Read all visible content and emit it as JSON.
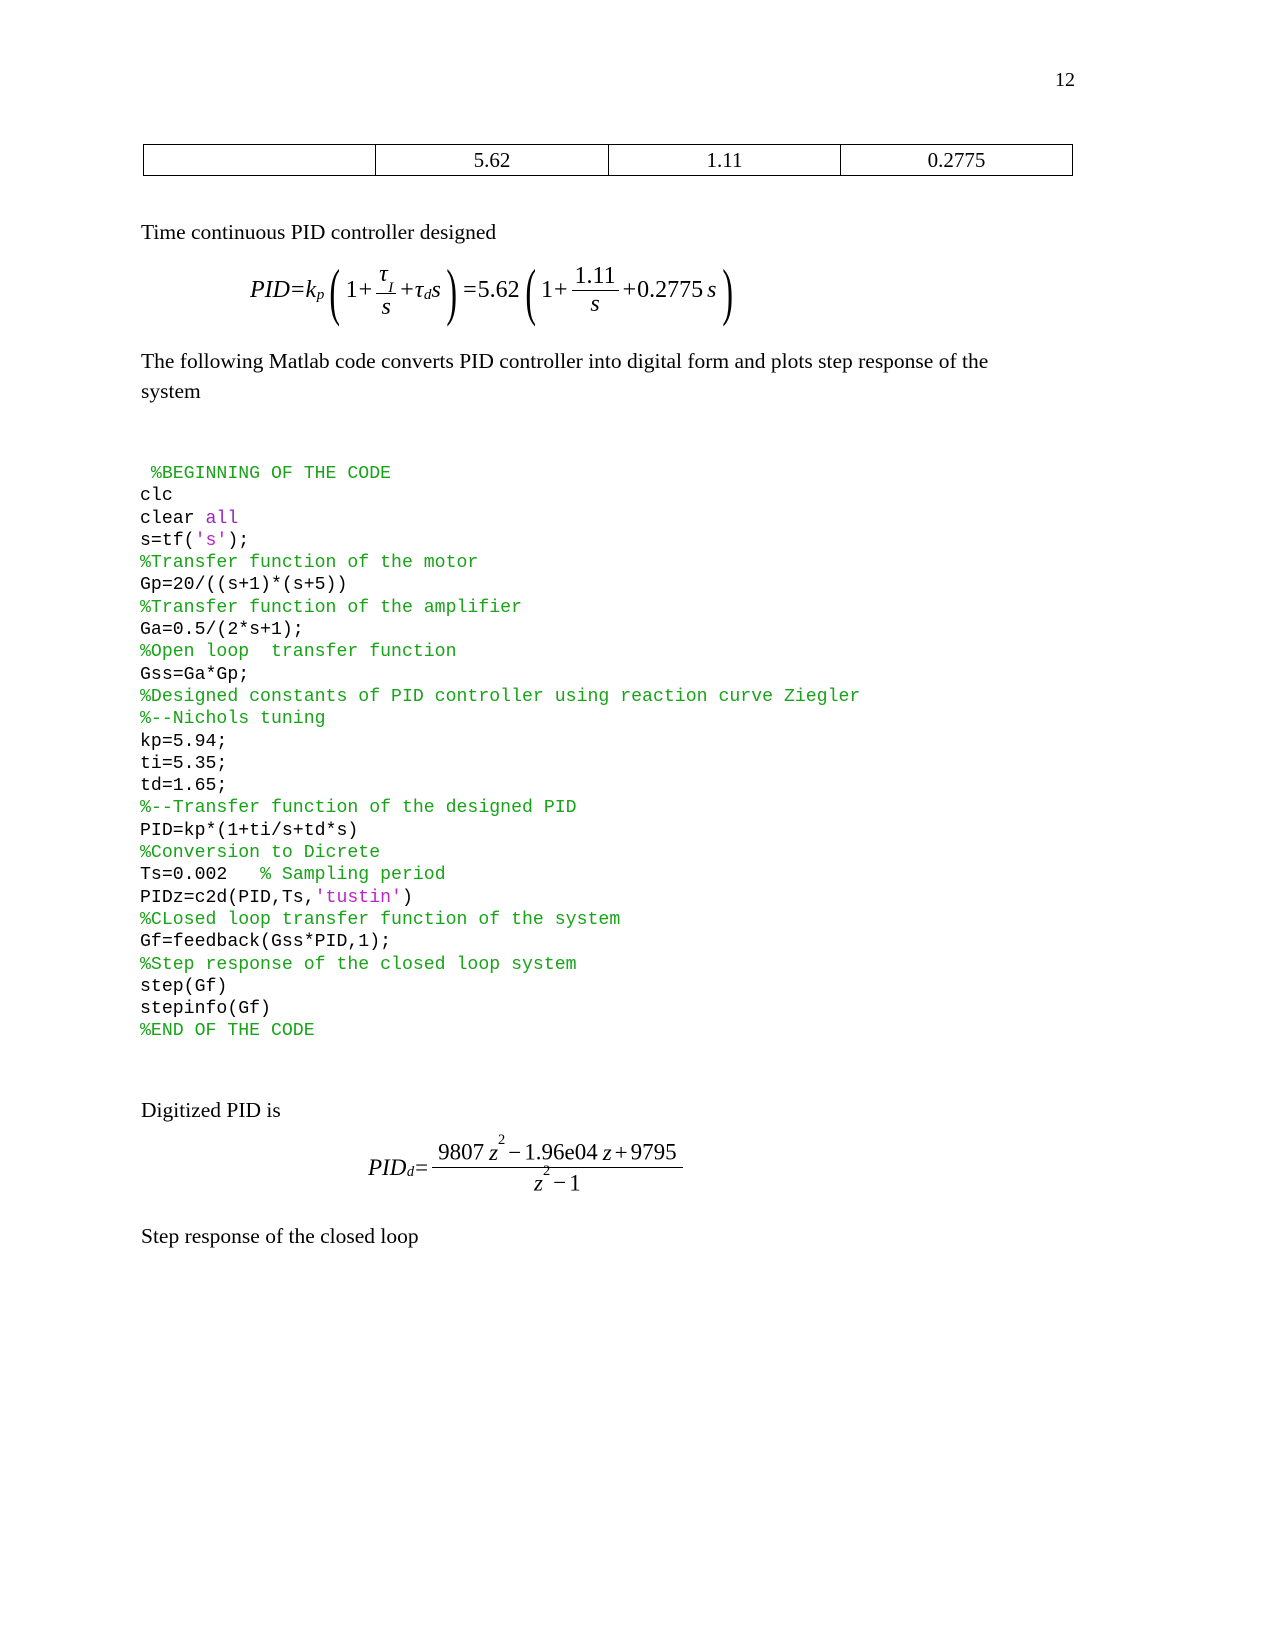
{
  "document": {
    "page_number": "12"
  },
  "table": {
    "rows": [
      {
        "cells": [
          "",
          "5.62",
          "1.11",
          "0.2775"
        ]
      }
    ]
  },
  "paragraphs": {
    "p1": "Time continuous PID controller designed",
    "p2": "The following Matlab code converts PID controller into digital form and plots step response of the system",
    "p3": "Digitized PID is",
    "p4": "Step response of the closed loop"
  },
  "equation_pid": {
    "lhs": "PID",
    "eq1": "=",
    "gain": "k",
    "gain_sub": "p",
    "open1": "(",
    "t1_one": "1",
    "t1_plus1": "+",
    "t1_num": "τ",
    "t1_num_sub": "I",
    "t1_den": "s",
    "t1_plus2": "+",
    "t1_tau": "τ",
    "t1_tau_sub": "d",
    "t1_s": "s",
    "close1": ")",
    "eq2": "=",
    "kp_value": "5.62",
    "open2": "(",
    "t2_one": "1",
    "t2_plus1": "+",
    "t2_num": "1.11",
    "t2_den": "s",
    "t2_plus2": "+",
    "t2_td": "0.2775",
    "t2_s": "s",
    "close2": ")"
  },
  "equation_digital": {
    "lhs": "PID",
    "lhs_sub": "d",
    "equals": "=",
    "numerator_a": "9807",
    "numerator_z1": "z",
    "numerator_z1_exp": "2",
    "numerator_minus": "−",
    "numerator_b": "1.96e04",
    "numerator_z2": "z",
    "numerator_plus": "+",
    "numerator_c": "9795",
    "denominator_z": "z",
    "denominator_exp": "2",
    "denominator_minus": "−",
    "denominator_one": "1"
  },
  "code": {
    "language": "matlab",
    "colors": {
      "comment": "#19a319",
      "string": "#b828c8",
      "keyword": "#9a25c2",
      "plain": "#000000"
    },
    "lines": [
      [
        {
          "t": "comment",
          "s": " %BEGINNING OF THE CODE"
        }
      ],
      [
        {
          "t": "plain",
          "s": "clc"
        }
      ],
      [
        {
          "t": "plain",
          "s": "clear "
        },
        {
          "t": "keyword",
          "s": "all"
        }
      ],
      [
        {
          "t": "plain",
          "s": "s=tf("
        },
        {
          "t": "string",
          "s": "'s'"
        },
        {
          "t": "plain",
          "s": ");"
        }
      ],
      [
        {
          "t": "comment",
          "s": "%Transfer function of the motor"
        }
      ],
      [
        {
          "t": "plain",
          "s": "Gp=20/((s+1)*(s+5))"
        }
      ],
      [
        {
          "t": "comment",
          "s": "%Transfer function of the amplifier"
        }
      ],
      [
        {
          "t": "plain",
          "s": "Ga=0.5/(2*s+1);"
        }
      ],
      [
        {
          "t": "comment",
          "s": "%Open loop  transfer function"
        }
      ],
      [
        {
          "t": "plain",
          "s": "Gss=Ga*Gp;"
        }
      ],
      [
        {
          "t": "comment",
          "s": "%Designed constants of PID controller using reaction curve Ziegler"
        }
      ],
      [
        {
          "t": "comment",
          "s": "%--Nichols tuning"
        }
      ],
      [
        {
          "t": "plain",
          "s": "kp=5.94;"
        }
      ],
      [
        {
          "t": "plain",
          "s": "ti=5.35;"
        }
      ],
      [
        {
          "t": "plain",
          "s": "td=1.65;"
        }
      ],
      [
        {
          "t": "comment",
          "s": "%--Transfer function of the designed PID"
        }
      ],
      [
        {
          "t": "plain",
          "s": "PID=kp*(1+ti/s+td*s)"
        }
      ],
      [
        {
          "t": "comment",
          "s": "%Conversion to Dicrete"
        }
      ],
      [
        {
          "t": "plain",
          "s": "Ts=0.002  "
        },
        {
          "t": "comment",
          "s": " % Sampling period"
        }
      ],
      [
        {
          "t": "plain",
          "s": "PIDz=c2d(PID,Ts,"
        },
        {
          "t": "string",
          "s": "'tustin'"
        },
        {
          "t": "plain",
          "s": ")"
        }
      ],
      [
        {
          "t": "comment",
          "s": "%CLosed loop transfer function of the system"
        }
      ],
      [
        {
          "t": "plain",
          "s": "Gf=feedback(Gss*PID,1);"
        }
      ],
      [
        {
          "t": "comment",
          "s": "%Step response of the closed loop system"
        }
      ],
      [
        {
          "t": "plain",
          "s": "step(Gf)"
        }
      ],
      [
        {
          "t": "plain",
          "s": "stepinfo(Gf)"
        }
      ],
      [
        {
          "t": "comment",
          "s": "%END OF THE CODE"
        }
      ]
    ]
  }
}
